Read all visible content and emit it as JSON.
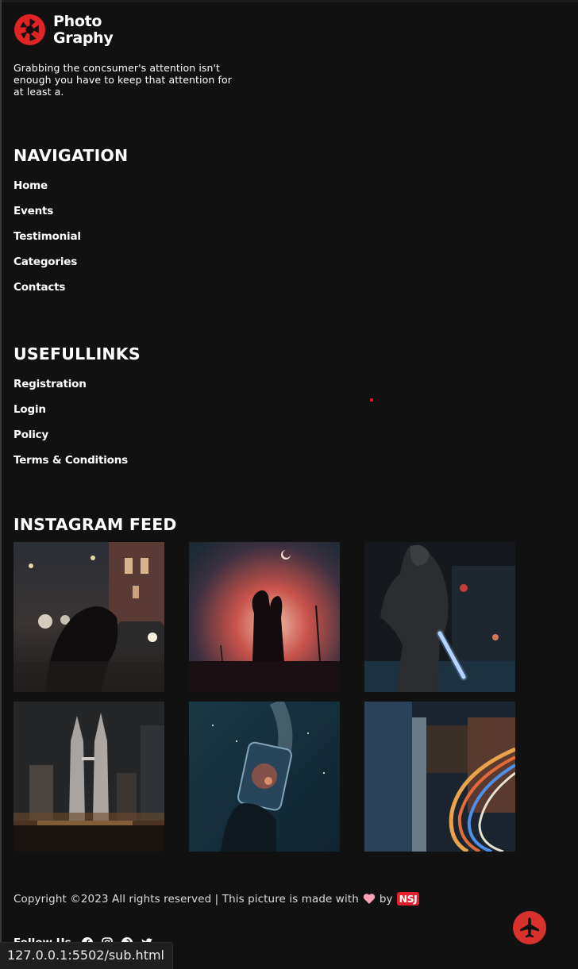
{
  "brand": {
    "line1": "Photo",
    "line2": "Graphy",
    "tagline": "Grabbing the concsumer's attention isn't enough you have to keep that attention for at least a."
  },
  "navigation": {
    "title": "NAVIGATION",
    "items": [
      "Home",
      "Events",
      "Testimonial",
      "Categories",
      "Contacts"
    ]
  },
  "useful_links": {
    "title": "USEFULLINKS",
    "items": [
      "Registration",
      "Login",
      "Policy",
      "Terms & Conditions"
    ]
  },
  "instagram": {
    "title": "INSTAGRAM FEED",
    "tiles": [
      "night-street-photo",
      "couple-silhouette-photo",
      "hooded-figure-photo",
      "city-towers-photo",
      "galaxy-jar-photo",
      "light-trails-photo"
    ]
  },
  "footer": {
    "copyright_text": "Copyright ©2023 All rights reserved | This picture is made with",
    "by_text": "by",
    "badge": "NSJ",
    "follow_label": "Follow Us"
  },
  "status_bar": {
    "url": "127.0.0.1:5502/sub.html"
  },
  "colors": {
    "background": "#111111",
    "accent": "#d9322c",
    "text": "#ffffff",
    "heart": "#f7a3b5"
  },
  "icons": [
    "aperture-logo-icon",
    "heart-icon",
    "facebook-icon",
    "instagram-icon",
    "pinterest-icon",
    "twitter-icon",
    "fighter-jet-icon"
  ]
}
